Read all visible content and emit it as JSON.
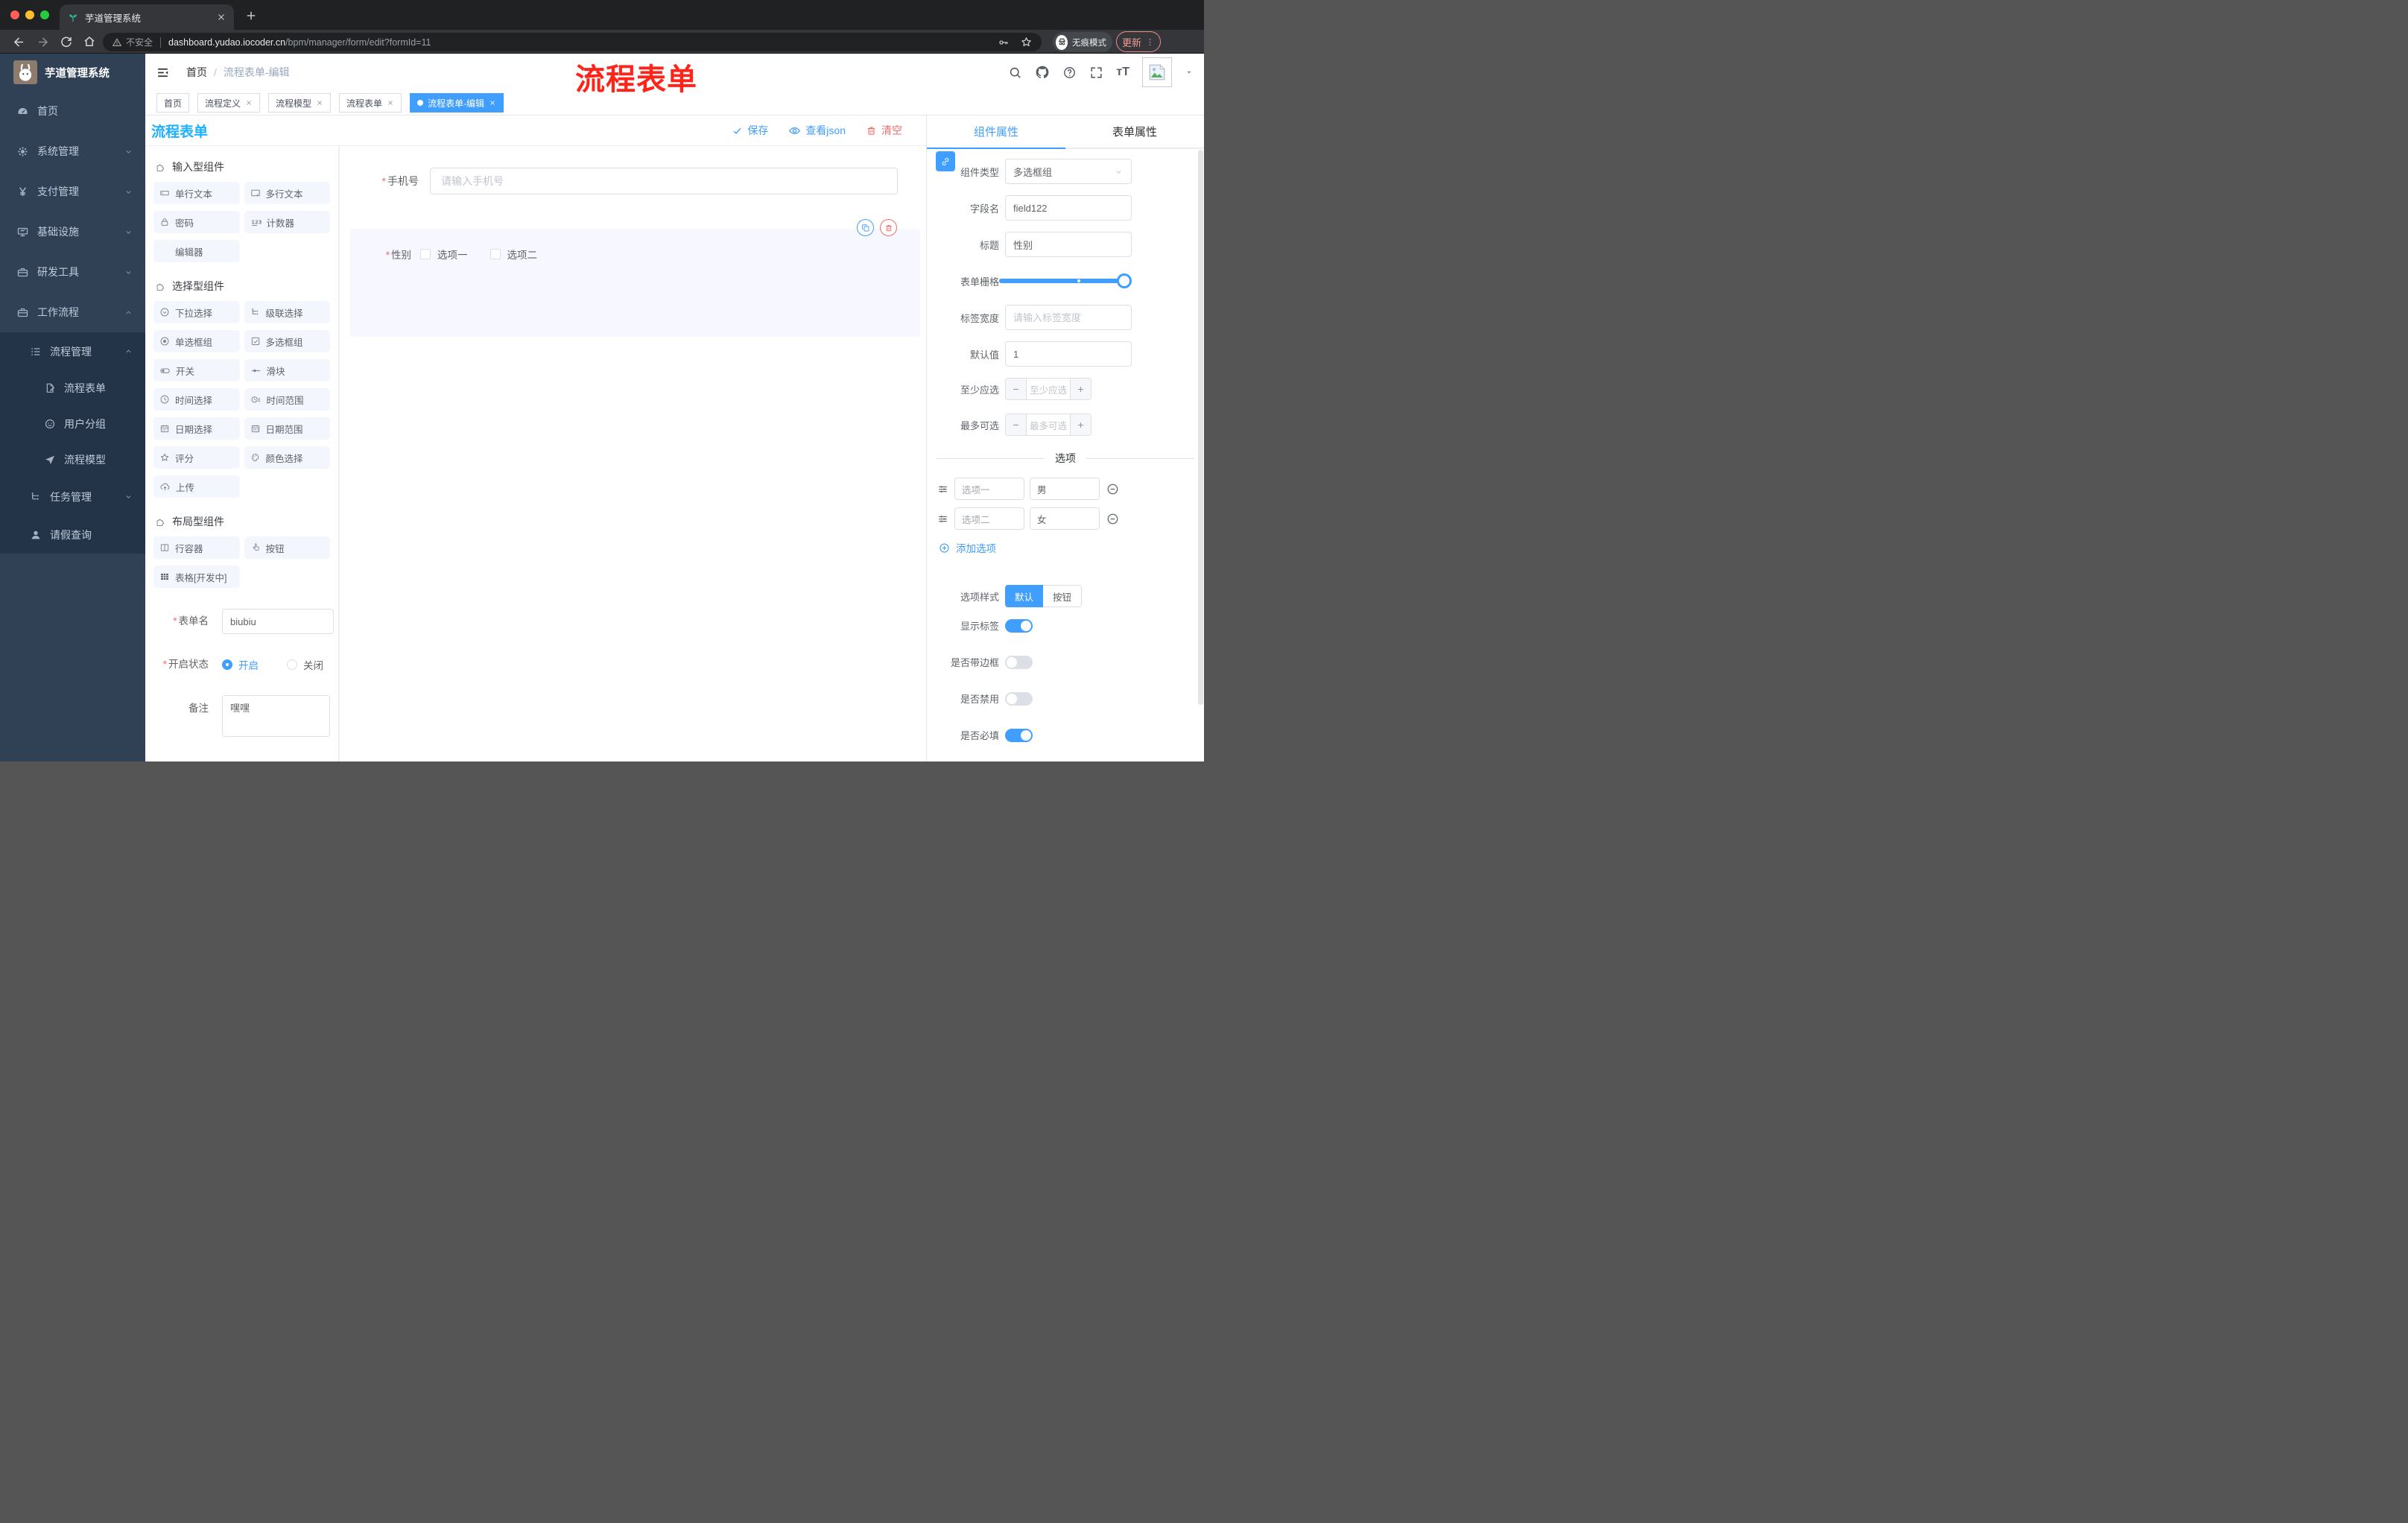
{
  "colors": {
    "primary": "#409eff",
    "danger": "#f56c6c",
    "designer_title_blue": "#1cb1ff",
    "annotation_red": "#fe2419",
    "sidebar_bg": "#304156",
    "submenu_bg": "#243448",
    "active_tag_bg": "#409eff"
  },
  "chrome": {
    "tab_title": "芋道管理系统",
    "security": "不安全",
    "host": "dashboard.yudao.iocoder.cn",
    "path": "/bpm/manager/form/edit?formId=11",
    "incognito": "无痕模式",
    "update": "更新"
  },
  "header": {
    "crumb_home": "首页",
    "crumb_sep": "/",
    "crumb_current": "流程表单-编辑",
    "annotation": "流程表单"
  },
  "tags": {
    "home": "首页",
    "def": "流程定义",
    "model": "流程模型",
    "form": "流程表单",
    "edit": "流程表单-编辑"
  },
  "sidebar": {
    "logo_title": "芋道管理系统",
    "home": "首页",
    "system": "系统管理",
    "pay": "支付管理",
    "infra": "基础设施",
    "dev": "研发工具",
    "workflow": "工作流程",
    "process_mgmt": "流程管理",
    "process_form": "流程表单",
    "user_group": "用户分组",
    "process_model": "流程模型",
    "task_mgmt": "任务管理",
    "leave_query": "请假查询"
  },
  "designer": {
    "title": "流程表单",
    "save": "保存",
    "view_json": "查看json",
    "clear": "清空"
  },
  "comps": {
    "group_input": "输入型组件",
    "group_select": "选择型组件",
    "group_layout": "布局型组件",
    "single_text": "单行文本",
    "multi_text": "多行文本",
    "password": "密码",
    "counter": "计数器",
    "editor": "编辑器",
    "select": "下拉选择",
    "cascader": "级联选择",
    "radio_group": "单选框组",
    "checkbox_group": "多选框组",
    "switch": "开关",
    "slider": "滑块",
    "time_picker": "时间选择",
    "time_range": "时间范围",
    "date_picker": "日期选择",
    "date_range": "日期范围",
    "rate": "评分",
    "color_picker": "颜色选择",
    "upload": "上传",
    "row_container": "行容器",
    "button": "按钮",
    "table_dev": "表格[开发中]"
  },
  "meta": {
    "name_label": "表单名",
    "name_value": "biubiu",
    "status_label": "开启状态",
    "status_on": "开启",
    "status_off": "关闭",
    "remark_label": "备注",
    "remark_value": "嘿嘿"
  },
  "canvas": {
    "phone_label": "手机号",
    "phone_placeholder": "请输入手机号",
    "gender_label": "性别",
    "gender_opt1": "选项一",
    "gender_opt2": "选项二"
  },
  "props": {
    "tab_component": "组件属性",
    "tab_form": "表单属性",
    "type_label": "组件类型",
    "type_value": "多选框组",
    "field_label": "字段名",
    "field_value": "field122",
    "title_label": "标题",
    "title_value": "性别",
    "grid_label": "表单栅格",
    "label_width_label": "标签宽度",
    "label_width_placeholder": "请输入标签宽度",
    "default_label": "默认值",
    "default_value": "1",
    "min_label": "至少应选",
    "min_placeholder": "至少应选",
    "max_label": "最多可选",
    "max_placeholder": "最多可选",
    "options_divider": "选项",
    "opt1_label": "选项一",
    "opt1_value": "男",
    "opt2_label": "选项二",
    "opt2_value": "女",
    "add_option": "添加选项",
    "style_label": "选项样式",
    "style_default": "默认",
    "style_button": "按钮",
    "show_label": "显示标签",
    "with_border": "是否带边框",
    "disabled": "是否禁用",
    "required": "是否必填"
  }
}
